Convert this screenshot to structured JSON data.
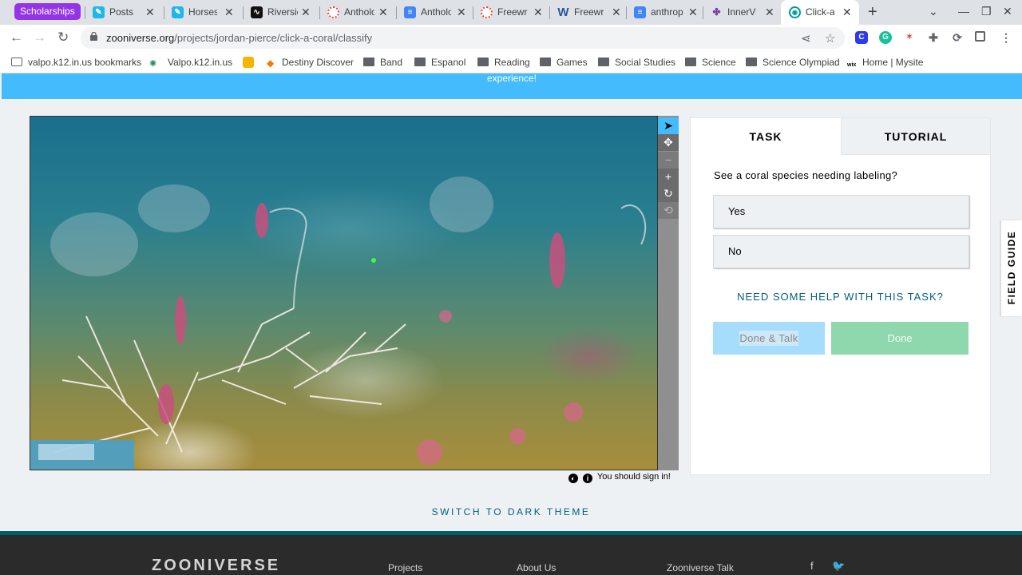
{
  "browser": {
    "tab_group": "Scholarships",
    "tabs": [
      {
        "label": "Posts",
        "icon": "document-icon"
      },
      {
        "label": "Horses",
        "icon": "document-icon"
      },
      {
        "label": "Riversic",
        "icon": "wave-icon"
      },
      {
        "label": "Antholo",
        "icon": "ring-icon"
      },
      {
        "label": "Antholo",
        "icon": "docs-icon"
      },
      {
        "label": "Freewri",
        "icon": "ring-icon"
      },
      {
        "label": "Freewri",
        "icon": "w-icon"
      },
      {
        "label": "anthrop",
        "icon": "docs-icon"
      },
      {
        "label": "InnerVi",
        "icon": "innervi-icon"
      },
      {
        "label": "Click-a",
        "icon": "zooniverse-icon"
      }
    ],
    "close_glyph": "✕",
    "new_tab": "+",
    "url_host": "zooniverse.org",
    "url_path": "/projects/jordan-pierce/click-a-coral/classify",
    "bookmarks": [
      "valpo.k12.in.us bookmarks",
      "Valpo.k12.in.us",
      "Destiny Discover",
      "Band",
      "Espanol",
      "Reading",
      "Games",
      "Social Studies",
      "Science",
      "Science Olympiad",
      "Home | Mysite"
    ]
  },
  "banner": {
    "text": "experience!",
    "color": "#43bbfd"
  },
  "classifier": {
    "image_alt": "Underwater seafloor with coral",
    "meta_text": "You should sign in!"
  },
  "task_panel": {
    "tab_task": "TASK",
    "tab_tutorial": "TUTORIAL",
    "question": "See a coral species needing labeling?",
    "answers": [
      "Yes",
      "No"
    ],
    "help": "NEED SOME HELP WITH THIS TASK?",
    "done_talk": "Done & Talk",
    "done": "Done"
  },
  "field_guide": "FIELD GUIDE",
  "switch_theme": "SWITCH TO DARK THEME",
  "footer": {
    "logo": "ZOONIVERSE",
    "links": [
      "Projects",
      "About Us",
      "Zooniverse Talk"
    ],
    "social": [
      "facebook-icon",
      "twitter-icon"
    ]
  }
}
